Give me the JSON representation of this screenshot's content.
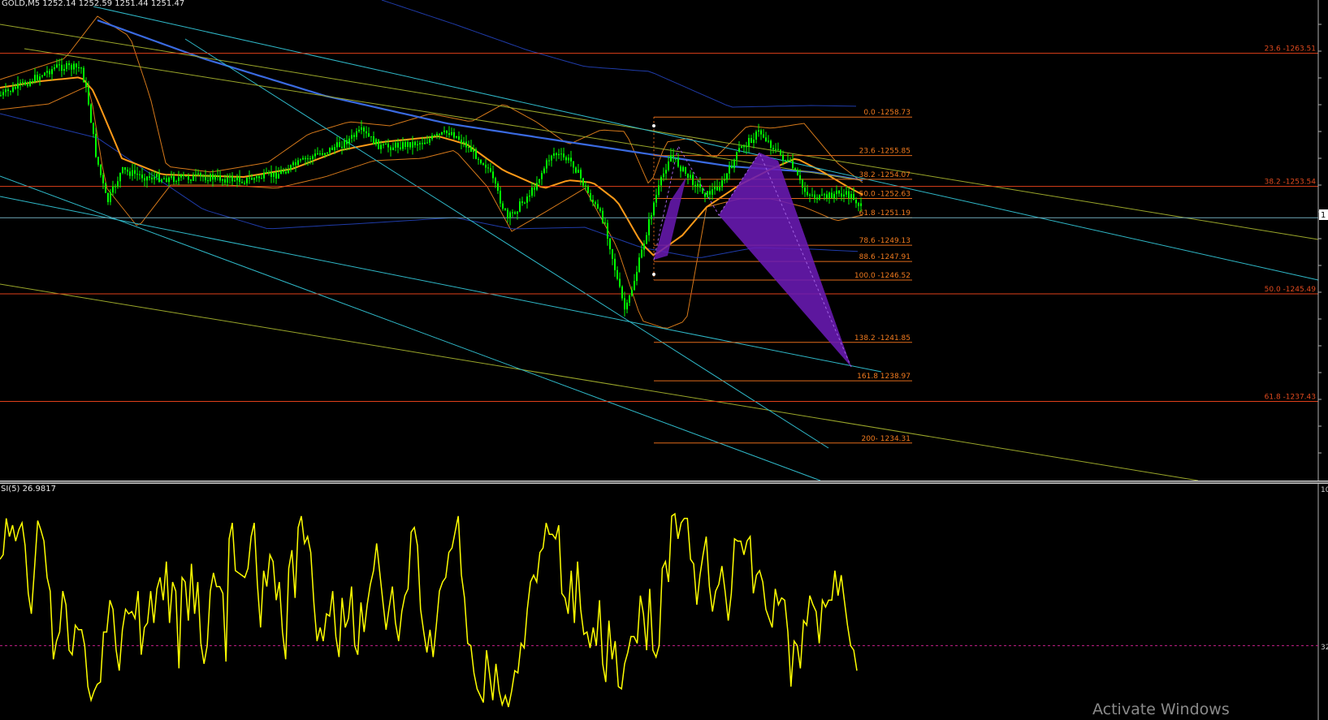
{
  "header": {
    "symbol_text": "GOLD,M5  1252.14 1252.59 1251.44 1251.47"
  },
  "subwindow": {
    "label": "SI(5) 26.9817",
    "axis_top": "10",
    "axis_level": "32"
  },
  "watermark": {
    "text": "Activate Windows"
  },
  "colors": {
    "background": "#000000",
    "candle": "#00ff00",
    "fib_long": "#e0401a",
    "fib_short": "#e06a1a",
    "fib_label_long": "#e04a1e",
    "fib_label_short": "#f07a1e",
    "trend_cyan": "#2fb8c8",
    "trend_olive": "#9aa62a",
    "ma_blue": "#3a6ae0",
    "ma_orange": "#ff9a18",
    "band_orange": "#d4781a",
    "band_navy": "#1f3ba8",
    "pattern_fill": "#6a1ab4",
    "rsi_line": "#ffff00",
    "rsi_level": "#c8208a"
  },
  "chart_data": {
    "type": "line",
    "title": "GOLD,M5",
    "ylim": [
      1231.5,
      1267.5
    ],
    "fib_long": [
      {
        "label": "23.6 -1263.51",
        "price": 1263.51
      },
      {
        "label": "38.2 -1253.54",
        "price": 1253.54
      },
      {
        "label": "50.0 -1245.49",
        "price": 1245.49
      },
      {
        "label": "61.8 -1237.43",
        "price": 1237.43
      }
    ],
    "fib_short": [
      {
        "label": "0.0 -1258.73",
        "price": 1258.73
      },
      {
        "label": "23.6 -1255.85",
        "price": 1255.85
      },
      {
        "label": "38.2 -1254.07",
        "price": 1254.07
      },
      {
        "label": "50.0 -1252.63",
        "price": 1252.63
      },
      {
        "label": "61.8 -1251.19",
        "price": 1251.19
      },
      {
        "label": "78.6 -1249.13",
        "price": 1249.13
      },
      {
        "label": "88.6 -1247.91",
        "price": 1247.91
      },
      {
        "label": "100.0 -1246.52",
        "price": 1246.52
      },
      {
        "label": "138.2 -1241.85",
        "price": 1241.85
      },
      {
        "label": "161.8 1238.97",
        "price": 1238.97
      },
      {
        "label": "200- 1234.31",
        "price": 1234.31
      }
    ],
    "current_price": 1251.19,
    "price_axis_label": "1",
    "rsi": {
      "label": "SI(5) 26.9817",
      "ylim": [
        0,
        100
      ],
      "level": 32,
      "values": [
        70,
        72,
        88,
        80,
        85,
        78,
        83,
        86,
        76,
        55,
        46,
        66,
        87,
        83,
        78,
        62,
        56,
        26,
        34,
        38,
        56,
        50,
        30,
        28,
        41,
        39,
        39,
        32,
        14,
        8,
        12,
        15,
        16,
        38,
        38,
        52,
        48,
        30,
        21,
        39,
        48,
        46,
        47,
        44,
        56,
        28,
        40,
        42,
        56,
        42,
        57,
        62,
        52,
        69,
        42,
        60,
        56,
        22,
        62,
        60,
        43,
        68,
        46,
        60,
        33,
        24,
        32,
        56,
        64,
        58,
        58,
        55,
        25,
        79,
        86,
        65,
        64,
        63,
        62,
        66,
        80,
        86,
        59,
        40,
        65,
        58,
        72,
        69,
        52,
        60,
        38,
        26,
        66,
        74,
        53,
        84,
        89,
        77,
        80,
        73,
        51,
        34,
        40,
        34,
        46,
        45,
        56,
        36,
        27,
        53,
        40,
        44,
        58,
        32,
        28,
        51,
        38,
        50,
        59,
        65,
        77,
        64,
        51,
        39,
        49,
        58,
        42,
        34,
        47,
        54,
        57,
        82,
        84,
        76,
        48,
        38,
        29,
        39,
        27,
        41,
        56,
        60,
        62,
        73,
        75,
        82,
        89,
        63,
        53,
        33,
        32,
        20,
        13,
        10,
        7,
        30,
        19,
        8,
        24,
        12,
        6,
        10,
        5,
        12,
        21,
        20,
        33,
        31,
        48,
        60,
        63,
        60,
        73,
        75,
        86,
        81,
        81,
        79,
        85,
        55,
        53,
        46,
        65,
        42,
        69,
        48,
        37,
        38,
        31,
        40,
        32,
        52,
        24,
        16,
        43,
        26,
        34,
        14,
        13,
        24,
        29,
        36,
        36,
        33,
        54,
        46,
        30,
        57,
        30,
        27,
        32,
        66,
        69,
        60,
        89,
        90,
        79,
        86,
        88,
        88,
        70,
        68,
        50,
        63,
        72,
        80,
        58,
        47,
        56,
        59,
        67,
        56,
        43,
        55,
        79,
        78,
        78,
        72,
        78,
        80,
        55,
        63,
        65,
        60,
        48,
        44,
        40,
        57,
        50,
        53,
        52,
        38,
        14,
        34,
        32,
        22,
        43,
        41,
        54,
        50,
        47,
        33,
        52,
        49,
        52,
        52,
        65,
        54,
        63,
        52,
        41,
        32,
        30,
        21
      ]
    }
  }
}
